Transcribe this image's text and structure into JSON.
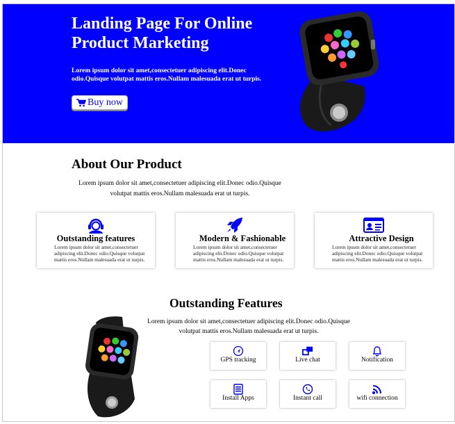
{
  "hero": {
    "title": "Landing Page For Online Product Marketing",
    "description": "Lorem ipsum dolor sit amet,consectetuer adipiscing elit.Donec odio.Quisque volutpat mattis eros.Nullam malesuada erat ut turpis.",
    "buy_label": "Buy now",
    "background": "#0000ff"
  },
  "about": {
    "title": "About Our Product",
    "text": "Lorem ipsum dolor sit amet,consectetuer adipiscing elit.Donec odio.Quisque volutpat mattis eros.Nullam malesuada erat ut turpis."
  },
  "cards": [
    {
      "icon": "support-agent-icon",
      "title": "Outstanding features",
      "text": "Lorem ipsum dolor sit amet,consectetuer adipiscing elit.Donec odio.Quisque volutpat mattis eros.Nullam malesuada erat ut turpis."
    },
    {
      "icon": "rocket-icon",
      "title": "Modern & Fashionable",
      "text": "Lorem ipsum dolor sit amet,consectetuer adipiscing elit.Donec odio.Quisque volutpat mattis eros.Nullam malesuada erat ut turpis."
    },
    {
      "icon": "id-card-icon",
      "title": "Attractive Design",
      "text": "Lorem ipsum dolor sit amet,consectetuer adipiscing elit.Donec odio.Quisque volutpat mattis eros.Nullam malesuada erat ut turpis."
    }
  ],
  "features": {
    "title": "Outstanding Features",
    "text": "Lorem ipsum dolor sit amet,consectetuer adipiscing elit.Donec odio.Quisque volutpat mattis eros.Nullam malesuada erat ut turpis.",
    "items": [
      {
        "icon": "gps-icon",
        "label": "GPS tracking"
      },
      {
        "icon": "chat-icon",
        "label": "Live chat"
      },
      {
        "icon": "bell-icon",
        "label": "Notification"
      },
      {
        "icon": "apps-icon",
        "label": "Install Apps"
      },
      {
        "icon": "call-icon",
        "label": "Instant call"
      },
      {
        "icon": "wifi-icon",
        "label": "wifi connection"
      }
    ]
  },
  "colors": {
    "accent": "#0000ff",
    "text": "#000000"
  }
}
